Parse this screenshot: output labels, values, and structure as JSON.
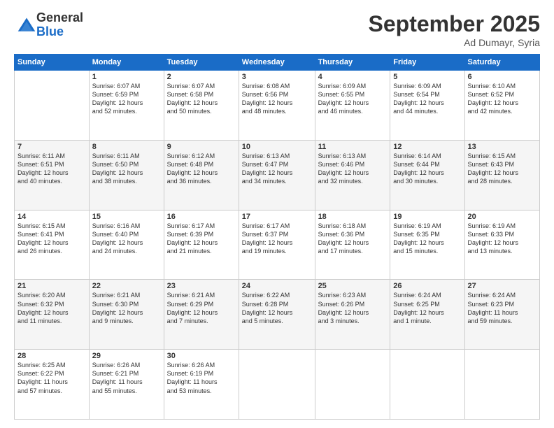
{
  "logo": {
    "general": "General",
    "blue": "Blue"
  },
  "header": {
    "title": "September 2025",
    "subtitle": "Ad Dumayr, Syria"
  },
  "days_of_week": [
    "Sunday",
    "Monday",
    "Tuesday",
    "Wednesday",
    "Thursday",
    "Friday",
    "Saturday"
  ],
  "weeks": [
    [
      {
        "day": "",
        "info": ""
      },
      {
        "day": "1",
        "info": "Sunrise: 6:07 AM\nSunset: 6:59 PM\nDaylight: 12 hours\nand 52 minutes."
      },
      {
        "day": "2",
        "info": "Sunrise: 6:07 AM\nSunset: 6:58 PM\nDaylight: 12 hours\nand 50 minutes."
      },
      {
        "day": "3",
        "info": "Sunrise: 6:08 AM\nSunset: 6:56 PM\nDaylight: 12 hours\nand 48 minutes."
      },
      {
        "day": "4",
        "info": "Sunrise: 6:09 AM\nSunset: 6:55 PM\nDaylight: 12 hours\nand 46 minutes."
      },
      {
        "day": "5",
        "info": "Sunrise: 6:09 AM\nSunset: 6:54 PM\nDaylight: 12 hours\nand 44 minutes."
      },
      {
        "day": "6",
        "info": "Sunrise: 6:10 AM\nSunset: 6:52 PM\nDaylight: 12 hours\nand 42 minutes."
      }
    ],
    [
      {
        "day": "7",
        "info": "Sunrise: 6:11 AM\nSunset: 6:51 PM\nDaylight: 12 hours\nand 40 minutes."
      },
      {
        "day": "8",
        "info": "Sunrise: 6:11 AM\nSunset: 6:50 PM\nDaylight: 12 hours\nand 38 minutes."
      },
      {
        "day": "9",
        "info": "Sunrise: 6:12 AM\nSunset: 6:48 PM\nDaylight: 12 hours\nand 36 minutes."
      },
      {
        "day": "10",
        "info": "Sunrise: 6:13 AM\nSunset: 6:47 PM\nDaylight: 12 hours\nand 34 minutes."
      },
      {
        "day": "11",
        "info": "Sunrise: 6:13 AM\nSunset: 6:46 PM\nDaylight: 12 hours\nand 32 minutes."
      },
      {
        "day": "12",
        "info": "Sunrise: 6:14 AM\nSunset: 6:44 PM\nDaylight: 12 hours\nand 30 minutes."
      },
      {
        "day": "13",
        "info": "Sunrise: 6:15 AM\nSunset: 6:43 PM\nDaylight: 12 hours\nand 28 minutes."
      }
    ],
    [
      {
        "day": "14",
        "info": "Sunrise: 6:15 AM\nSunset: 6:41 PM\nDaylight: 12 hours\nand 26 minutes."
      },
      {
        "day": "15",
        "info": "Sunrise: 6:16 AM\nSunset: 6:40 PM\nDaylight: 12 hours\nand 24 minutes."
      },
      {
        "day": "16",
        "info": "Sunrise: 6:17 AM\nSunset: 6:39 PM\nDaylight: 12 hours\nand 21 minutes."
      },
      {
        "day": "17",
        "info": "Sunrise: 6:17 AM\nSunset: 6:37 PM\nDaylight: 12 hours\nand 19 minutes."
      },
      {
        "day": "18",
        "info": "Sunrise: 6:18 AM\nSunset: 6:36 PM\nDaylight: 12 hours\nand 17 minutes."
      },
      {
        "day": "19",
        "info": "Sunrise: 6:19 AM\nSunset: 6:35 PM\nDaylight: 12 hours\nand 15 minutes."
      },
      {
        "day": "20",
        "info": "Sunrise: 6:19 AM\nSunset: 6:33 PM\nDaylight: 12 hours\nand 13 minutes."
      }
    ],
    [
      {
        "day": "21",
        "info": "Sunrise: 6:20 AM\nSunset: 6:32 PM\nDaylight: 12 hours\nand 11 minutes."
      },
      {
        "day": "22",
        "info": "Sunrise: 6:21 AM\nSunset: 6:30 PM\nDaylight: 12 hours\nand 9 minutes."
      },
      {
        "day": "23",
        "info": "Sunrise: 6:21 AM\nSunset: 6:29 PM\nDaylight: 12 hours\nand 7 minutes."
      },
      {
        "day": "24",
        "info": "Sunrise: 6:22 AM\nSunset: 6:28 PM\nDaylight: 12 hours\nand 5 minutes."
      },
      {
        "day": "25",
        "info": "Sunrise: 6:23 AM\nSunset: 6:26 PM\nDaylight: 12 hours\nand 3 minutes."
      },
      {
        "day": "26",
        "info": "Sunrise: 6:24 AM\nSunset: 6:25 PM\nDaylight: 12 hours\nand 1 minute."
      },
      {
        "day": "27",
        "info": "Sunrise: 6:24 AM\nSunset: 6:23 PM\nDaylight: 11 hours\nand 59 minutes."
      }
    ],
    [
      {
        "day": "28",
        "info": "Sunrise: 6:25 AM\nSunset: 6:22 PM\nDaylight: 11 hours\nand 57 minutes."
      },
      {
        "day": "29",
        "info": "Sunrise: 6:26 AM\nSunset: 6:21 PM\nDaylight: 11 hours\nand 55 minutes."
      },
      {
        "day": "30",
        "info": "Sunrise: 6:26 AM\nSunset: 6:19 PM\nDaylight: 11 hours\nand 53 minutes."
      },
      {
        "day": "",
        "info": ""
      },
      {
        "day": "",
        "info": ""
      },
      {
        "day": "",
        "info": ""
      },
      {
        "day": "",
        "info": ""
      }
    ]
  ]
}
